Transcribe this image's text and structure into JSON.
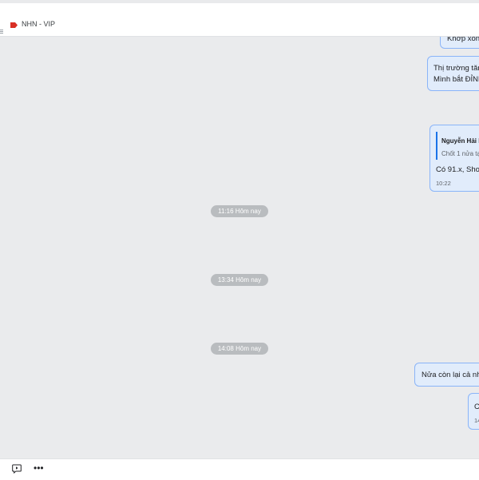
{
  "header": {
    "label_name": "NHN - VIP",
    "label_color": "#d93025"
  },
  "messages": [
    {
      "text": "Khớp xong"
    },
    {
      "line1": "Thị trường tăn",
      "line2": "Mình bắt ĐỈNH"
    },
    {
      "quote_name": "Nguyễn Hải l",
      "quote_text": "Chốt 1 nửa tạ",
      "text": "Có 91.x, Shor",
      "time": "10:22"
    },
    {
      "text": "Nửa còn lại cả nh"
    },
    {
      "text": "C",
      "time": "14"
    }
  ],
  "separators": [
    {
      "label": "11:16 Hôm nay"
    },
    {
      "label": "13:34 Hôm nay"
    },
    {
      "label": "14:08 Hôm nay"
    }
  ],
  "footer": {
    "more_label": "•••"
  }
}
